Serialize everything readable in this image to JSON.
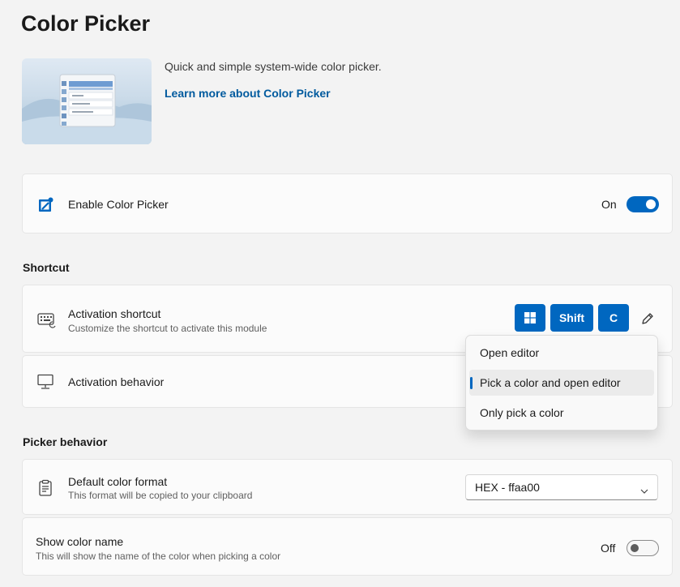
{
  "page": {
    "title": "Color Picker"
  },
  "hero": {
    "description": "Quick and simple system-wide color picker.",
    "link": "Learn more about Color Picker"
  },
  "enable": {
    "label": "Enable Color Picker",
    "state": "On"
  },
  "shortcut_section": {
    "header": "Shortcut",
    "activation_shortcut": {
      "title": "Activation shortcut",
      "subtitle": "Customize the shortcut to activate this module",
      "keys": [
        "Win",
        "Shift",
        "C"
      ]
    },
    "activation_behavior": {
      "title": "Activation behavior",
      "options": [
        "Open editor",
        "Pick a color and open editor",
        "Only pick a color"
      ],
      "selected": "Pick a color and open editor"
    }
  },
  "picker_section": {
    "header": "Picker behavior",
    "default_format": {
      "title": "Default color format",
      "subtitle": "This format will be copied to your clipboard",
      "value": "HEX - ffaa00"
    },
    "show_color_name": {
      "title": "Show color name",
      "subtitle": "This will show the name of the color when picking a color",
      "state": "Off"
    }
  },
  "colors": {
    "accent": "#0067c0",
    "background": "#f3f3f3",
    "card": "#fbfbfb"
  }
}
